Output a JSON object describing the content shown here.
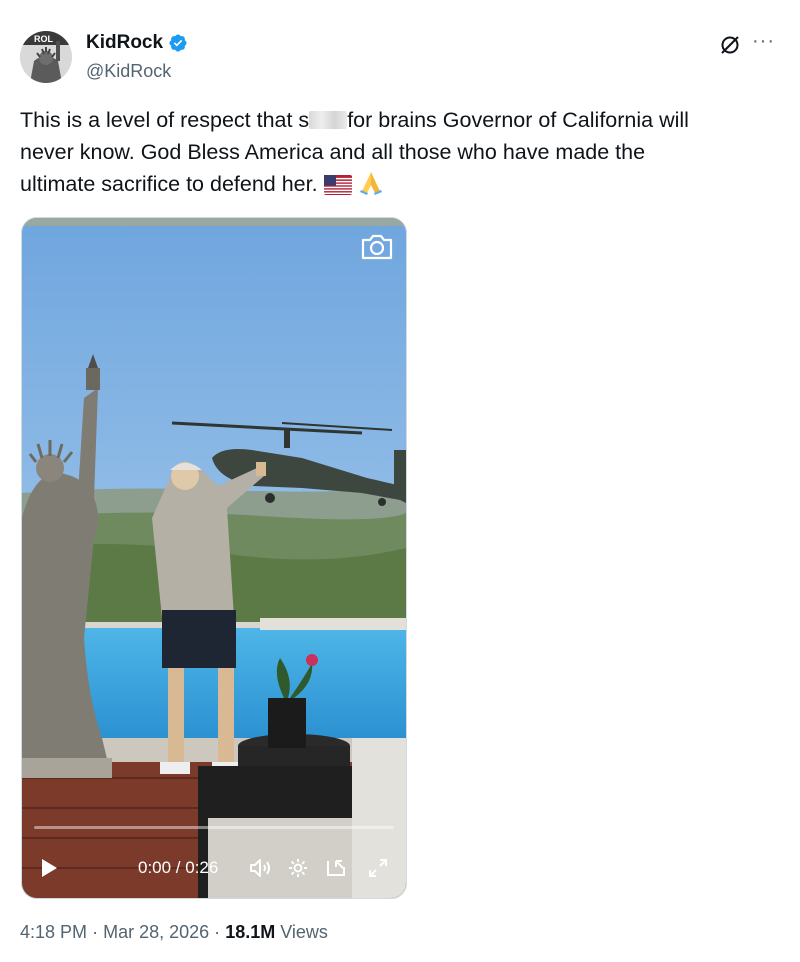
{
  "author": {
    "display_name": "KidRock",
    "handle": "@KidRock",
    "verified": true,
    "avatar_text": "ROL"
  },
  "tweet": {
    "line1_a": "This is a level of respect that s",
    "line1_b": "for brains Governor of California will",
    "line2": "never know. God Bless America and all those who have made the",
    "line3": "ultimate sacrifice to defend her.",
    "emojis": [
      "us-flag-icon",
      "folded-hands-icon"
    ]
  },
  "video": {
    "time_display": "0:00 / 0:26",
    "progress": 0
  },
  "meta": {
    "time": "4:18 PM",
    "separator": "·",
    "date": "Mar 28, 2026",
    "views_count": "18.1M",
    "views_label": "Views"
  },
  "colors": {
    "text_primary": "#0f1419",
    "text_secondary": "#536471",
    "verified_blue": "#1d9bf0"
  }
}
